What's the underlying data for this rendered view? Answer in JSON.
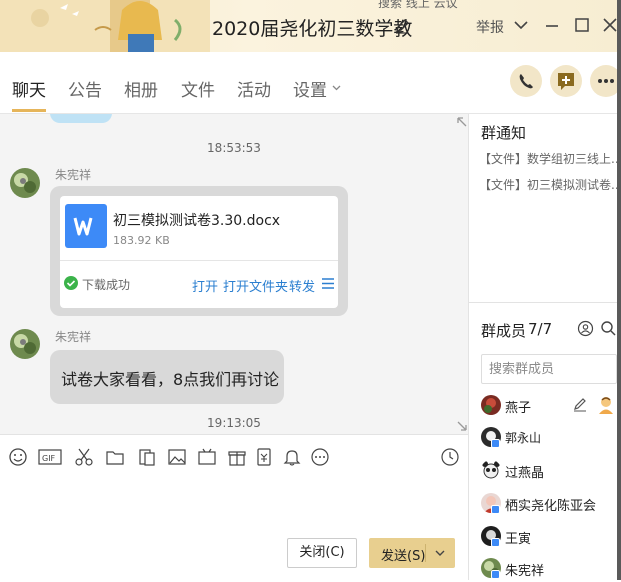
{
  "titlebar": {
    "title": "2020届尧化初三数学教",
    "report": "举报",
    "top_cut": "搜索   线上 云议"
  },
  "tabs": [
    {
      "label": "聊天"
    },
    {
      "label": "公告"
    },
    {
      "label": "相册"
    },
    {
      "label": "文件"
    },
    {
      "label": "活动"
    },
    {
      "label": "设置"
    }
  ],
  "chat": {
    "time1": "18:53:53",
    "sender1": "朱宪祥",
    "file": {
      "name": "初三模拟测试卷3.30.docx",
      "size": "183.92 KB",
      "status": "下载成功",
      "open": "打开",
      "open_folder": "打开文件夹",
      "forward": "转发"
    },
    "sender2": "朱宪祥",
    "message": "试卷大家看看，8点我们再讨论",
    "time2": "19:13:05"
  },
  "compose": {
    "close_label": "关闭(C)",
    "send_label": "发送(S)"
  },
  "sidebar": {
    "notice_title": "群通知",
    "notices": [
      "【文件】数学组初三线上...",
      "【文件】初三模拟测试卷..."
    ],
    "members_title": "群成员",
    "members_count": "7/7",
    "search_placeholder": "搜索群成员",
    "members": [
      {
        "name": "燕子"
      },
      {
        "name": "郭永山"
      },
      {
        "name": "过燕晶"
      },
      {
        "name": "栖实尧化陈亚会"
      },
      {
        "name": "王寅"
      },
      {
        "name": "朱宪祥"
      }
    ]
  },
  "colors": {
    "accent": "#e8cf8f",
    "link": "#2b7fd0",
    "file_icon": "#3d8af7",
    "success": "#3bb34a"
  }
}
